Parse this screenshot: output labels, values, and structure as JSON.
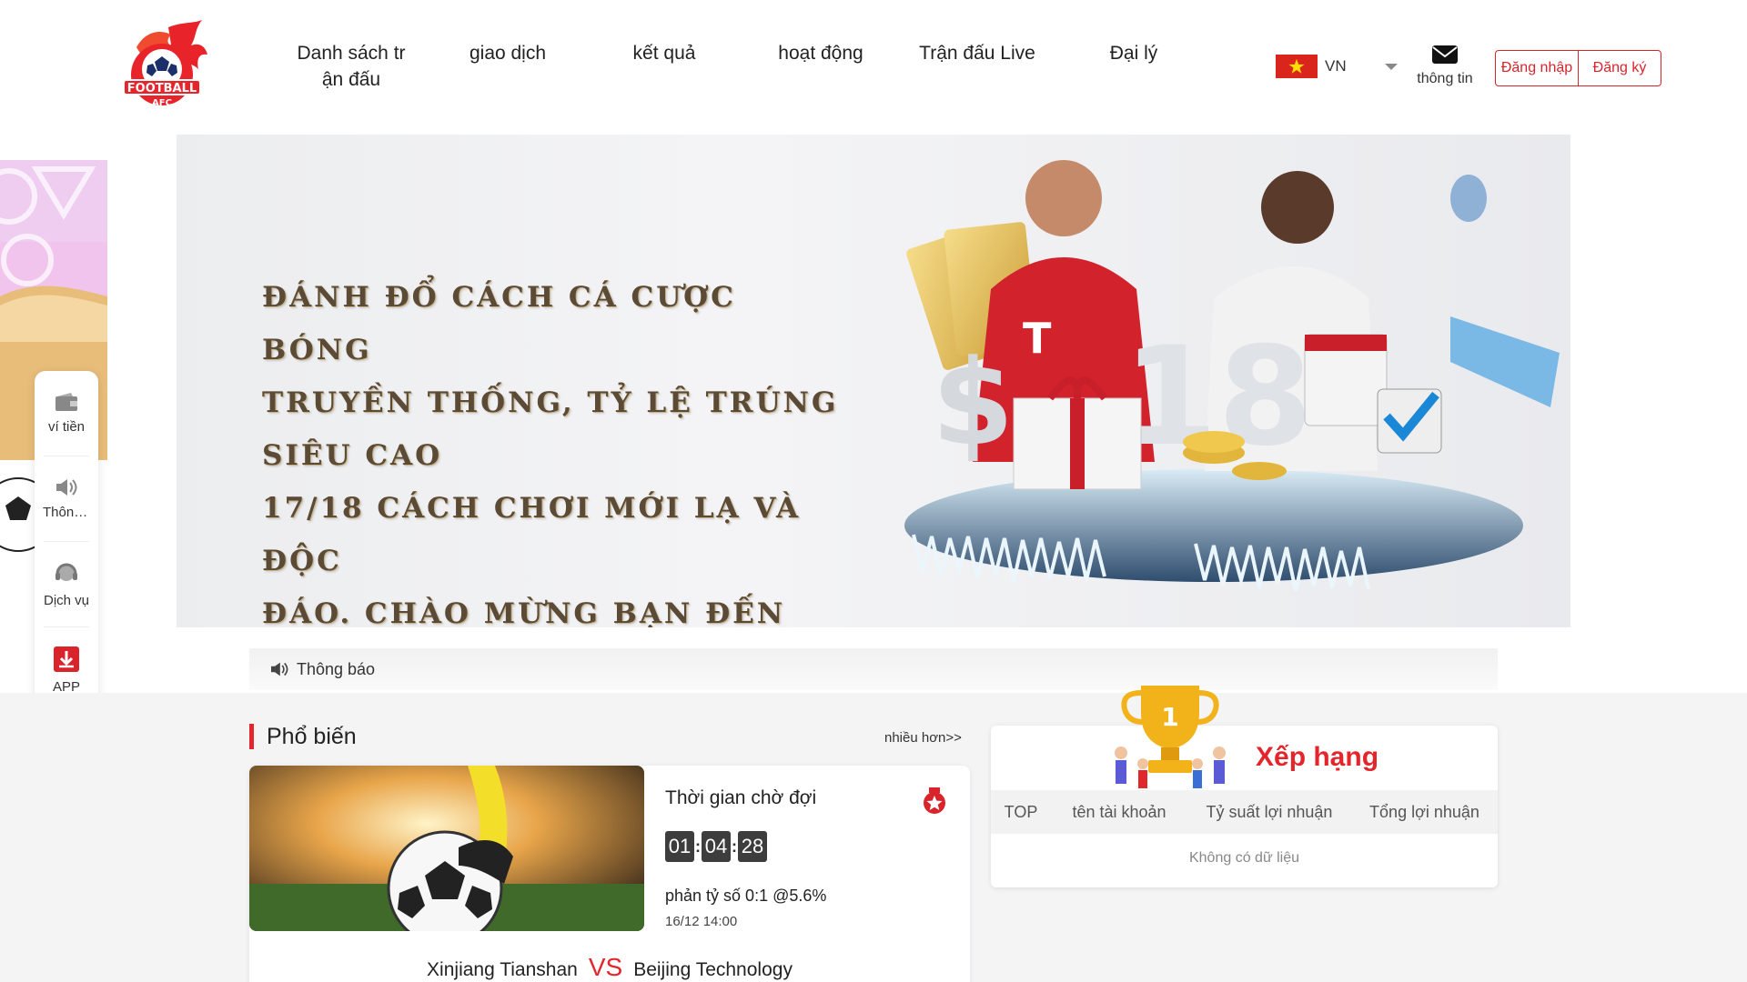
{
  "header": {
    "logo_text": "FOOTBALL",
    "logo_sub": "AFC",
    "nav": [
      {
        "label": "Danh sách trận đấu"
      },
      {
        "label": "giao dịch"
      },
      {
        "label": "kết quả"
      },
      {
        "label": "hoạt động"
      },
      {
        "label": "Trận đấu Live"
      },
      {
        "label": "Đại lý"
      }
    ],
    "language": "VN",
    "message_label": "thông tin",
    "login_label": "Đăng nhập",
    "register_label": "Đăng ký"
  },
  "banner": {
    "lines": [
      "Đánh đổ cách cá cược bóng",
      "truyền thống, tỷ lệ trúng siêu cao",
      " 17/18 cách chơi mới lạ và độc",
      "đáo. Chào mừng bạn đến với AFC"
    ],
    "art_number": "18"
  },
  "side_menu": [
    {
      "label": "ví tiền",
      "icon": "wallet-icon"
    },
    {
      "label": "Thông báo",
      "icon": "speaker-icon"
    },
    {
      "label": "Dịch vụ",
      "icon": "headset-icon"
    },
    {
      "label": "APP",
      "icon": "download-icon"
    }
  ],
  "notice": {
    "label": "Thông báo"
  },
  "popular": {
    "title": "Phổ biến",
    "more": "nhiều hơn>>",
    "match": {
      "wait_label": "Thời gian chờ đợi",
      "countdown": [
        "01",
        "04",
        "28"
      ],
      "odds": "phản tỷ số 0:1 @5.6%",
      "time": "16/12 14:00",
      "home": "Xinjiang Tianshan",
      "vs": "VS",
      "away": "Beijing Technology"
    }
  },
  "ranking": {
    "title": "Xếp hạng",
    "columns": [
      "TOP",
      "tên tài khoản",
      "Tỷ suất lợi nhuận",
      "Tổng lợi nhuận"
    ],
    "empty": "Không có dữ liệu"
  },
  "colors": {
    "accent": "#e3262c",
    "brand_red": "#d9242b"
  }
}
